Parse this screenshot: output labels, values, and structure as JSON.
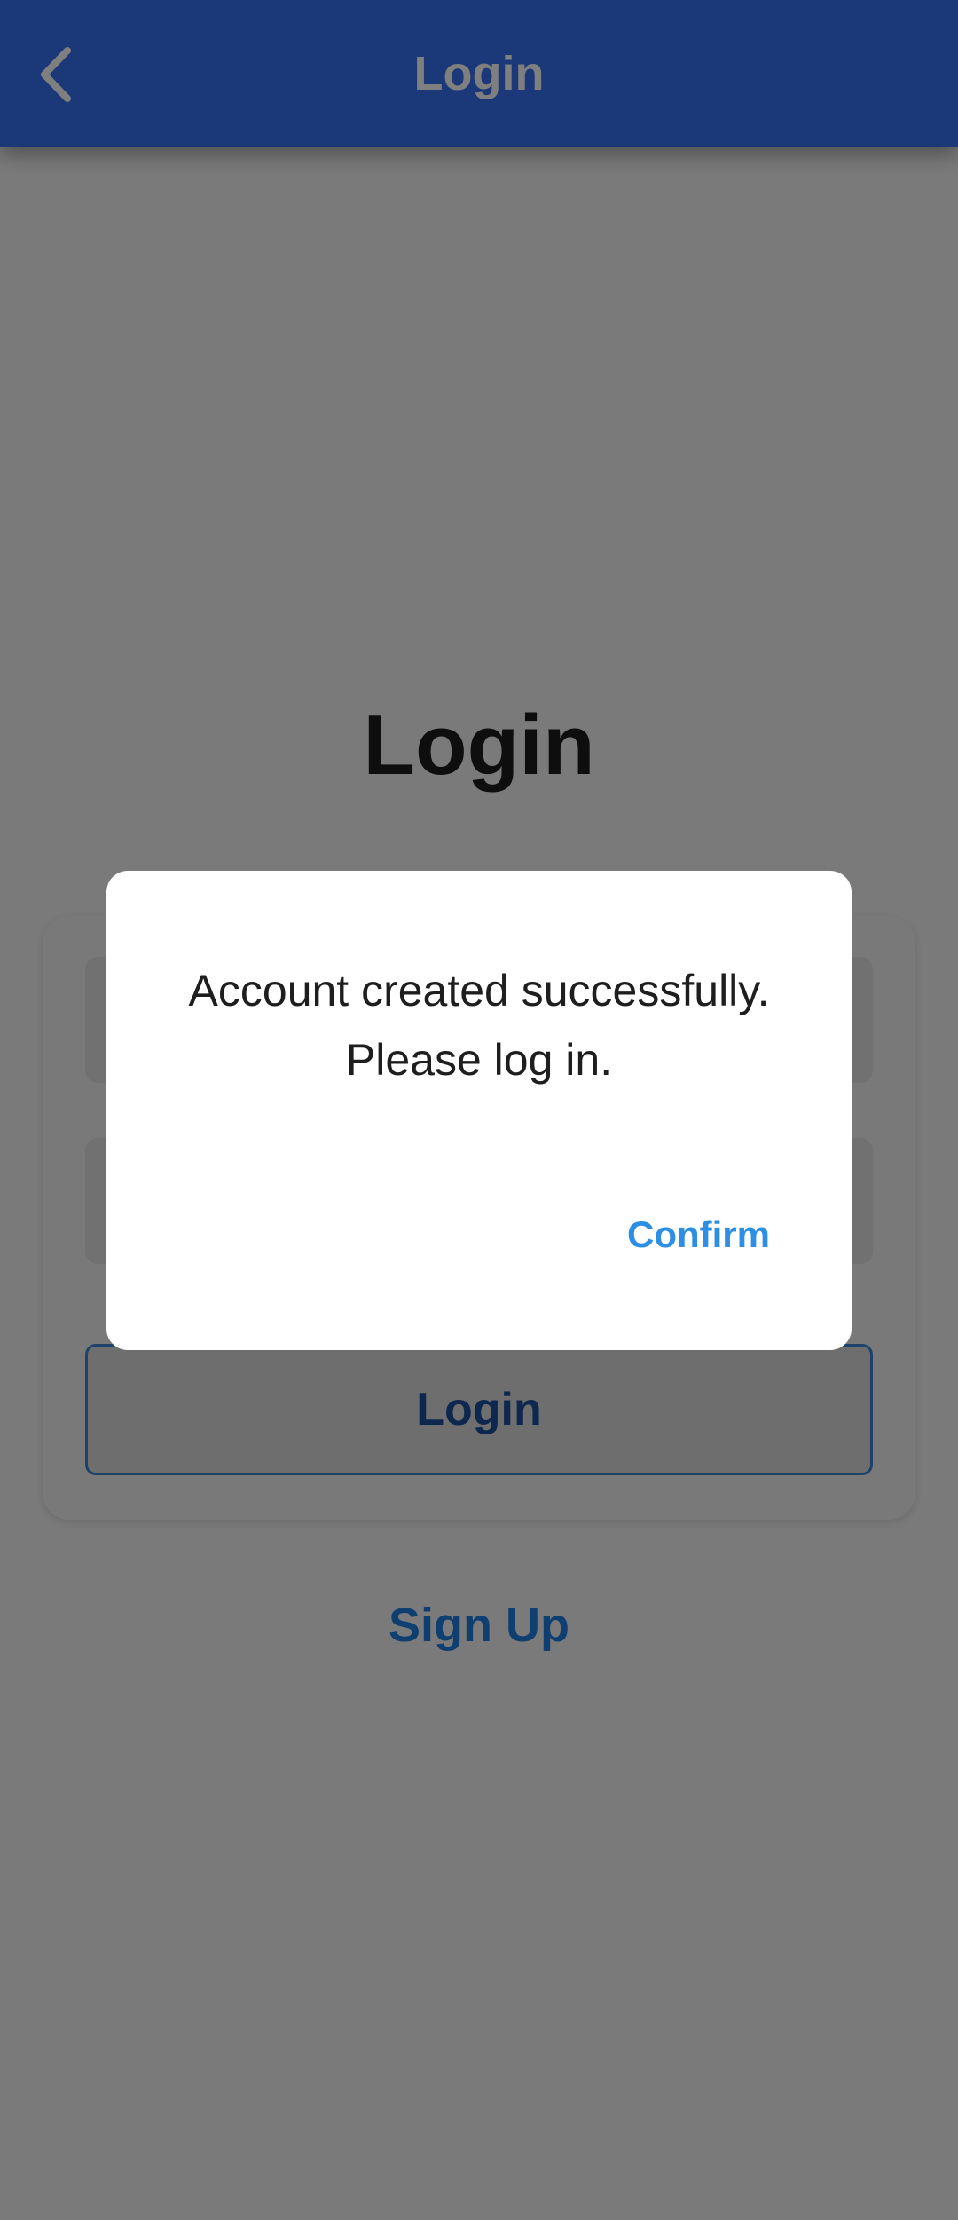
{
  "app_bar": {
    "title": "Login",
    "back_icon": "chevron-left-icon",
    "color": "#3670f0"
  },
  "page": {
    "heading": "Login",
    "username_value": "",
    "password_value": "",
    "login_button_label": "Login",
    "signup_label": "Sign Up"
  },
  "dialog": {
    "message": "Account created successfully. Please log in.",
    "confirm_label": "Confirm",
    "accent_color": "#2d8fe3"
  }
}
